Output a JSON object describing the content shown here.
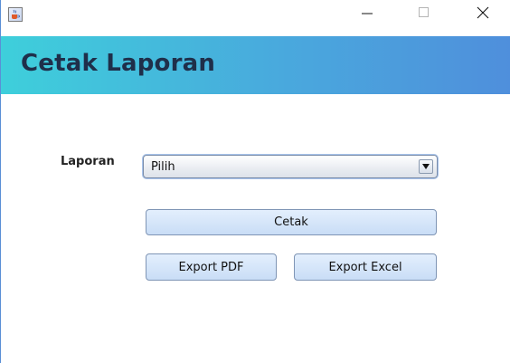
{
  "window": {
    "icon": "java-cup-icon",
    "controls": {
      "minimize": "minimize-icon",
      "maximize": "maximize-icon",
      "close": "close-icon"
    }
  },
  "header": {
    "title": "Cetak Laporan",
    "gradient_colors": [
      "#3ecfdb",
      "#49a9dd",
      "#4f8fdc"
    ],
    "title_color": "#1f2f4a"
  },
  "form": {
    "laporan_label": "Laporan",
    "laporan_select": {
      "value": "Pilih",
      "arrow_icon": "dropdown-arrow-icon"
    }
  },
  "buttons": {
    "cetak": "Cetak",
    "export_pdf": "Export PDF",
    "export_excel": "Export Excel"
  }
}
